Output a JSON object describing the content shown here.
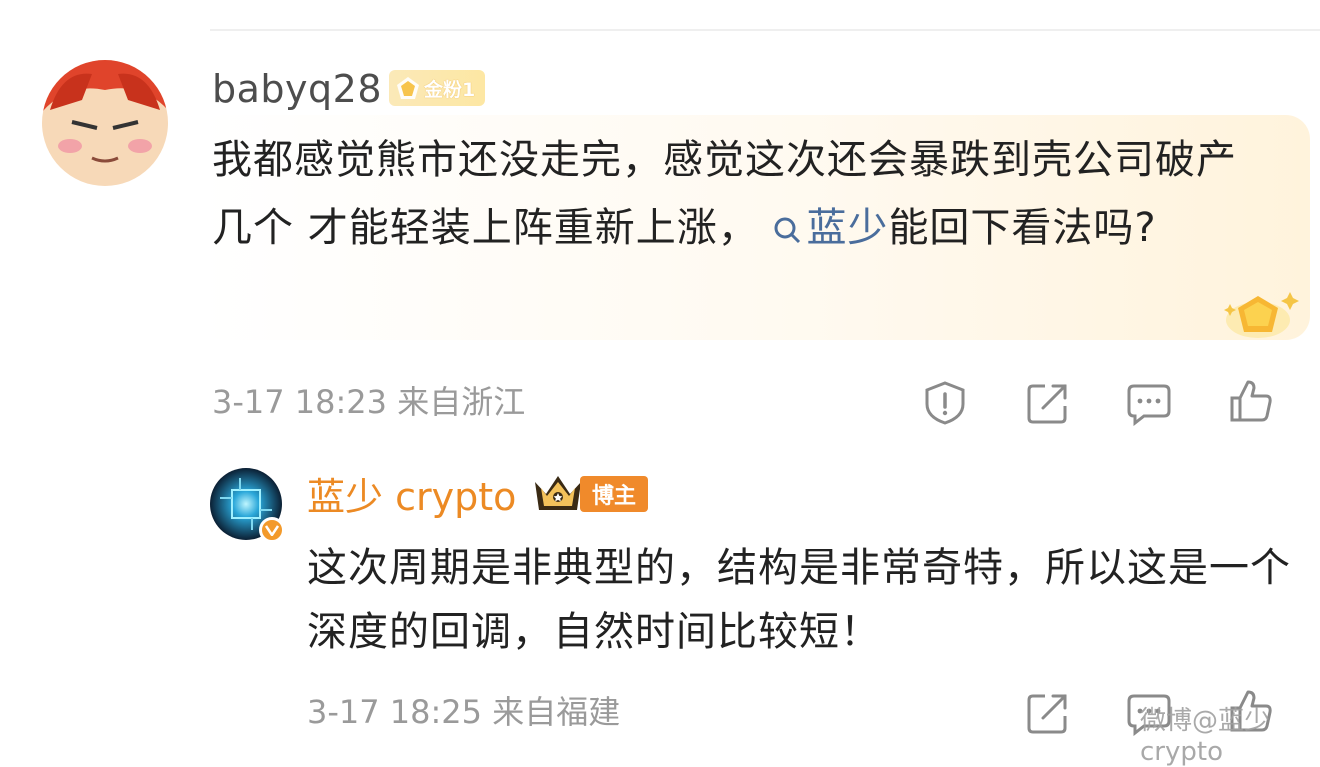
{
  "comment": {
    "username": "babyq28",
    "badge": "金粉1",
    "text_before": "我都感觉熊市还没走完，感觉这次还会暴跌到壳公司破产几个 才能轻装上阵重新上涨，",
    "mention": "蓝少",
    "text_after": "能回下看法吗?",
    "time": "3-17 18:23",
    "location": "来自浙江"
  },
  "reply": {
    "username": "蓝少 crypto",
    "badge": "博主",
    "text": "这次周期是非典型的，结构是非常奇特，所以这是一个深度的回调，自然时间比较短！",
    "time": "3-17 18:25",
    "location": "来自福建"
  },
  "watermark": "微博@蓝少crypto",
  "colors": {
    "reply_username": "#ec8a24",
    "mention": "#4a6d9c",
    "meta": "#9a9a9a",
    "host_badge": "#f08a2b"
  },
  "icons": [
    "report-icon",
    "share-icon",
    "comment-icon",
    "like-icon",
    "verified-icon",
    "crown-icon",
    "search-icon",
    "gem-icon"
  ]
}
